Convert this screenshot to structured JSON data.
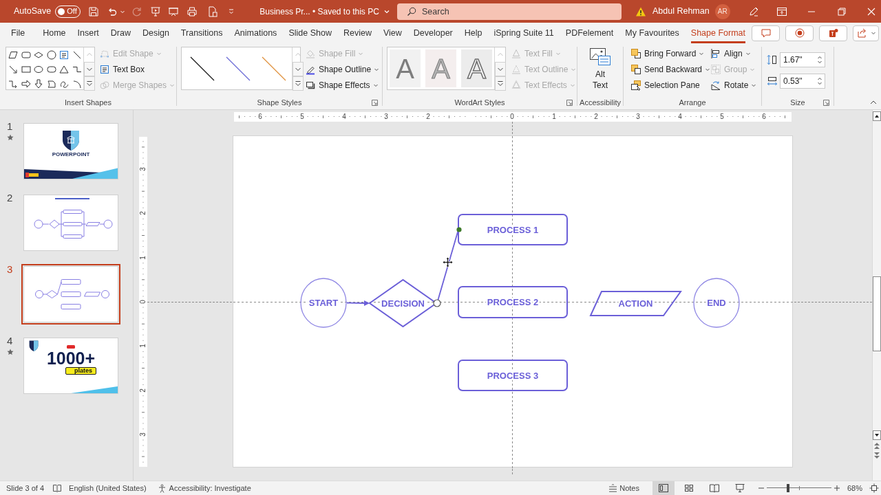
{
  "title_bar": {
    "autosave_label": "AutoSave",
    "autosave_toggle": {
      "on": false,
      "label": "Off"
    },
    "document_title": "Business Pr... • Saved to this PC",
    "search": {
      "placeholder": "Search"
    },
    "user": {
      "name": "Abdul Rehman",
      "initials": "AR"
    }
  },
  "tabs": [
    {
      "label": "File",
      "selected": false
    },
    {
      "label": "Home",
      "selected": false
    },
    {
      "label": "Insert",
      "selected": false
    },
    {
      "label": "Draw",
      "selected": false
    },
    {
      "label": "Design",
      "selected": false
    },
    {
      "label": "Transitions",
      "selected": false
    },
    {
      "label": "Animations",
      "selected": false
    },
    {
      "label": "Slide Show",
      "selected": false
    },
    {
      "label": "Review",
      "selected": false
    },
    {
      "label": "View",
      "selected": false
    },
    {
      "label": "Developer",
      "selected": false
    },
    {
      "label": "Help",
      "selected": false
    },
    {
      "label": "iSpring Suite 11",
      "selected": false
    },
    {
      "label": "PDFelement",
      "selected": false
    },
    {
      "label": "My Favourites",
      "selected": false
    },
    {
      "label": "Shape Format",
      "selected": true
    }
  ],
  "ribbon": {
    "insert_shapes": {
      "label": "Insert Shapes",
      "commands": [
        {
          "label": "Edit Shape",
          "disabled": true,
          "dropdown": true
        },
        {
          "label": "Text Box",
          "disabled": false,
          "dropdown": false
        },
        {
          "label": "Merge Shapes",
          "disabled": true,
          "dropdown": true
        }
      ]
    },
    "shape_styles": {
      "label": "Shape Styles",
      "presets": [
        {
          "color": "#1a1a1a"
        },
        {
          "color": "#6b6bd6"
        },
        {
          "color": "#e0913e"
        }
      ],
      "commands": [
        {
          "label": "Shape Fill",
          "disabled": true,
          "dropdown": true
        },
        {
          "label": "Shape Outline",
          "disabled": false,
          "dropdown": true
        },
        {
          "label": "Shape Effects",
          "disabled": false,
          "dropdown": true
        }
      ]
    },
    "wordart_styles": {
      "label": "WordArt Styles",
      "presets": [
        {
          "letter": "A",
          "kind": "solid"
        },
        {
          "letter": "A",
          "kind": "light"
        },
        {
          "letter": "A",
          "kind": "outline"
        }
      ],
      "commands": [
        {
          "label": "Text Fill",
          "disabled": true,
          "dropdown": true
        },
        {
          "label": "Text Outline",
          "disabled": true,
          "dropdown": true
        },
        {
          "label": "Text Effects",
          "disabled": true,
          "dropdown": true
        }
      ]
    },
    "accessibility": {
      "label": "Accessibility",
      "button": "Alt Text"
    },
    "arrange": {
      "label": "Arrange",
      "commands": [
        {
          "label": "Bring Forward",
          "disabled": false,
          "dropdown": true
        },
        {
          "label": "Send Backward",
          "disabled": false,
          "dropdown": true
        },
        {
          "label": "Selection Pane",
          "disabled": false,
          "dropdown": false
        },
        {
          "label": "Align",
          "disabled": false,
          "dropdown": true
        },
        {
          "label": "Group",
          "disabled": true,
          "dropdown": true
        },
        {
          "label": "Rotate",
          "disabled": false,
          "dropdown": true
        }
      ]
    },
    "size": {
      "label": "Size",
      "height": "1.67\"",
      "width": "0.53\""
    }
  },
  "slides": [
    {
      "number": "1",
      "selected": false,
      "animated": true,
      "kind": "title",
      "title": "POWERPOINT"
    },
    {
      "number": "2",
      "selected": false,
      "animated": false,
      "kind": "flowchart"
    },
    {
      "number": "3",
      "selected": true,
      "animated": false,
      "kind": "flowchart_draft"
    },
    {
      "number": "4",
      "selected": false,
      "animated": true,
      "kind": "promo",
      "headline": "1000+",
      "badge": "plates"
    }
  ],
  "rulers": {
    "horizontal": [
      "6",
      "5",
      "4",
      "3",
      "2",
      "0",
      "1",
      "2",
      "3",
      "4",
      "5",
      "6"
    ],
    "vertical": [
      "3",
      "2",
      "1",
      "0",
      "1",
      "2",
      "3"
    ]
  },
  "slide": {
    "nodes": [
      {
        "kind": "terminal",
        "label": "START"
      },
      {
        "kind": "decision",
        "label": "DECISION"
      },
      {
        "kind": "process",
        "label": "PROCESS 1"
      },
      {
        "kind": "process",
        "label": "PROCESS 2"
      },
      {
        "kind": "process",
        "label": "PROCESS 3"
      },
      {
        "kind": "data",
        "label": "ACTION"
      },
      {
        "kind": "terminal",
        "label": "END"
      }
    ],
    "connectors": [
      {
        "kind": "arrow",
        "selected": false
      },
      {
        "kind": "line",
        "selected": true
      }
    ]
  },
  "status_bar": {
    "slide_info": "Slide 3 of 4",
    "language": "English (United States)",
    "accessibility": "Accessibility: Investigate",
    "notes": "Notes",
    "views": [
      {
        "selected": true
      },
      {
        "selected": false
      },
      {
        "selected": false
      },
      {
        "selected": false
      }
    ],
    "zoom": {
      "level": 0.33,
      "label": "68%"
    }
  }
}
